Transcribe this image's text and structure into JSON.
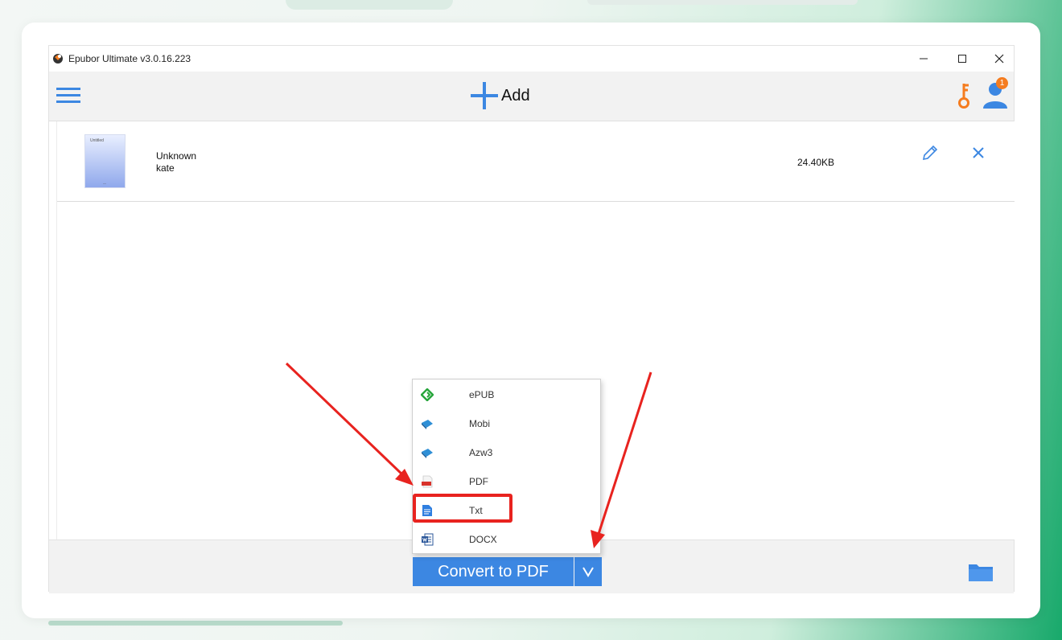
{
  "window": {
    "title": "Epubor Ultimate v3.0.16.223"
  },
  "toolbar": {
    "add_label": "Add",
    "notification_count": "1"
  },
  "book": {
    "cover_title": "Untitled",
    "title": "Unknown",
    "author": "kate",
    "size": "24.40KB"
  },
  "bottom": {
    "convert_label": "Convert to PDF"
  },
  "formats": [
    {
      "label": "ePUB",
      "icon": "epub-icon"
    },
    {
      "label": "Mobi",
      "icon": "mobi-icon"
    },
    {
      "label": "Azw3",
      "icon": "azw3-icon"
    },
    {
      "label": "PDF",
      "icon": "pdf-icon"
    },
    {
      "label": "Txt",
      "icon": "txt-icon"
    },
    {
      "label": "DOCX",
      "icon": "docx-icon"
    }
  ],
  "annotation": {
    "highlighted_item": "Txt",
    "color": "#e8231f"
  },
  "colors": {
    "accent": "#3c87e2",
    "key": "#f57c1f"
  }
}
